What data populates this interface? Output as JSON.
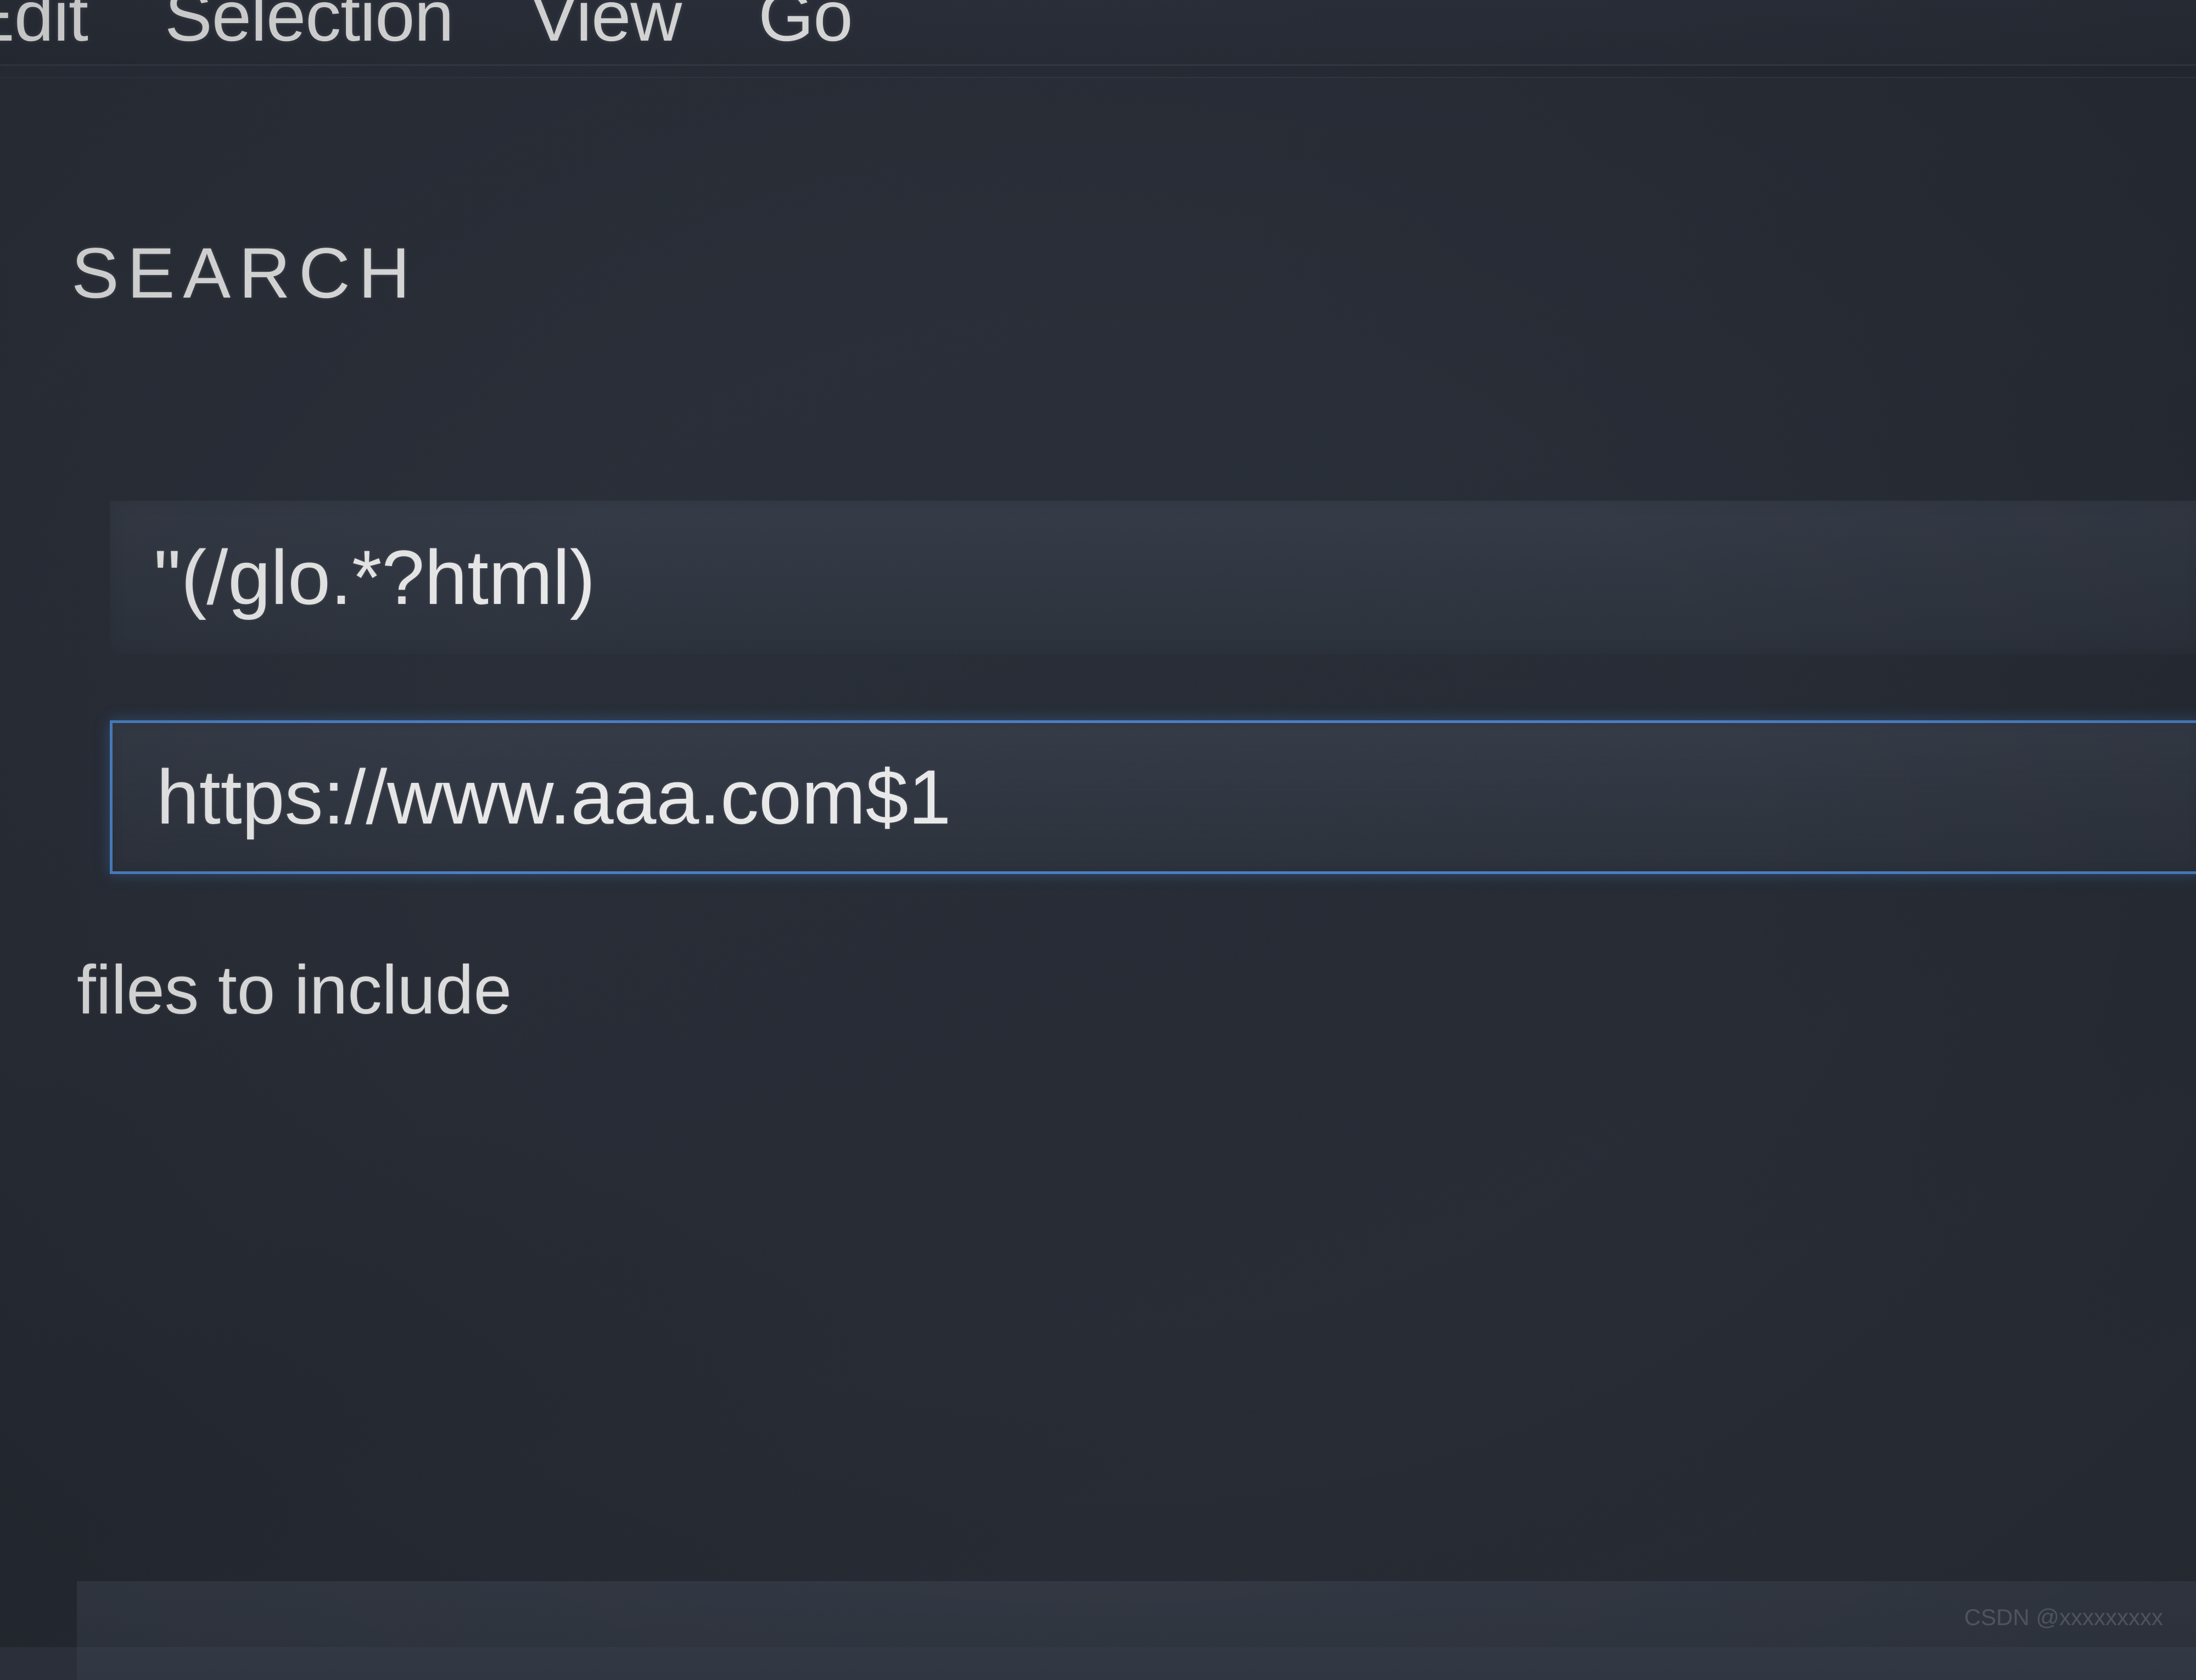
{
  "menubar": {
    "items": [
      "Edit",
      "Selection",
      "View",
      "Go"
    ]
  },
  "search": {
    "title": "SEARCH",
    "search_input": "\"(/glo.*?html)",
    "replace_input": "https://www.aaa.com$1",
    "files_to_include_label": "files to include"
  },
  "watermark": "CSDN @xxxxxxxxx"
}
